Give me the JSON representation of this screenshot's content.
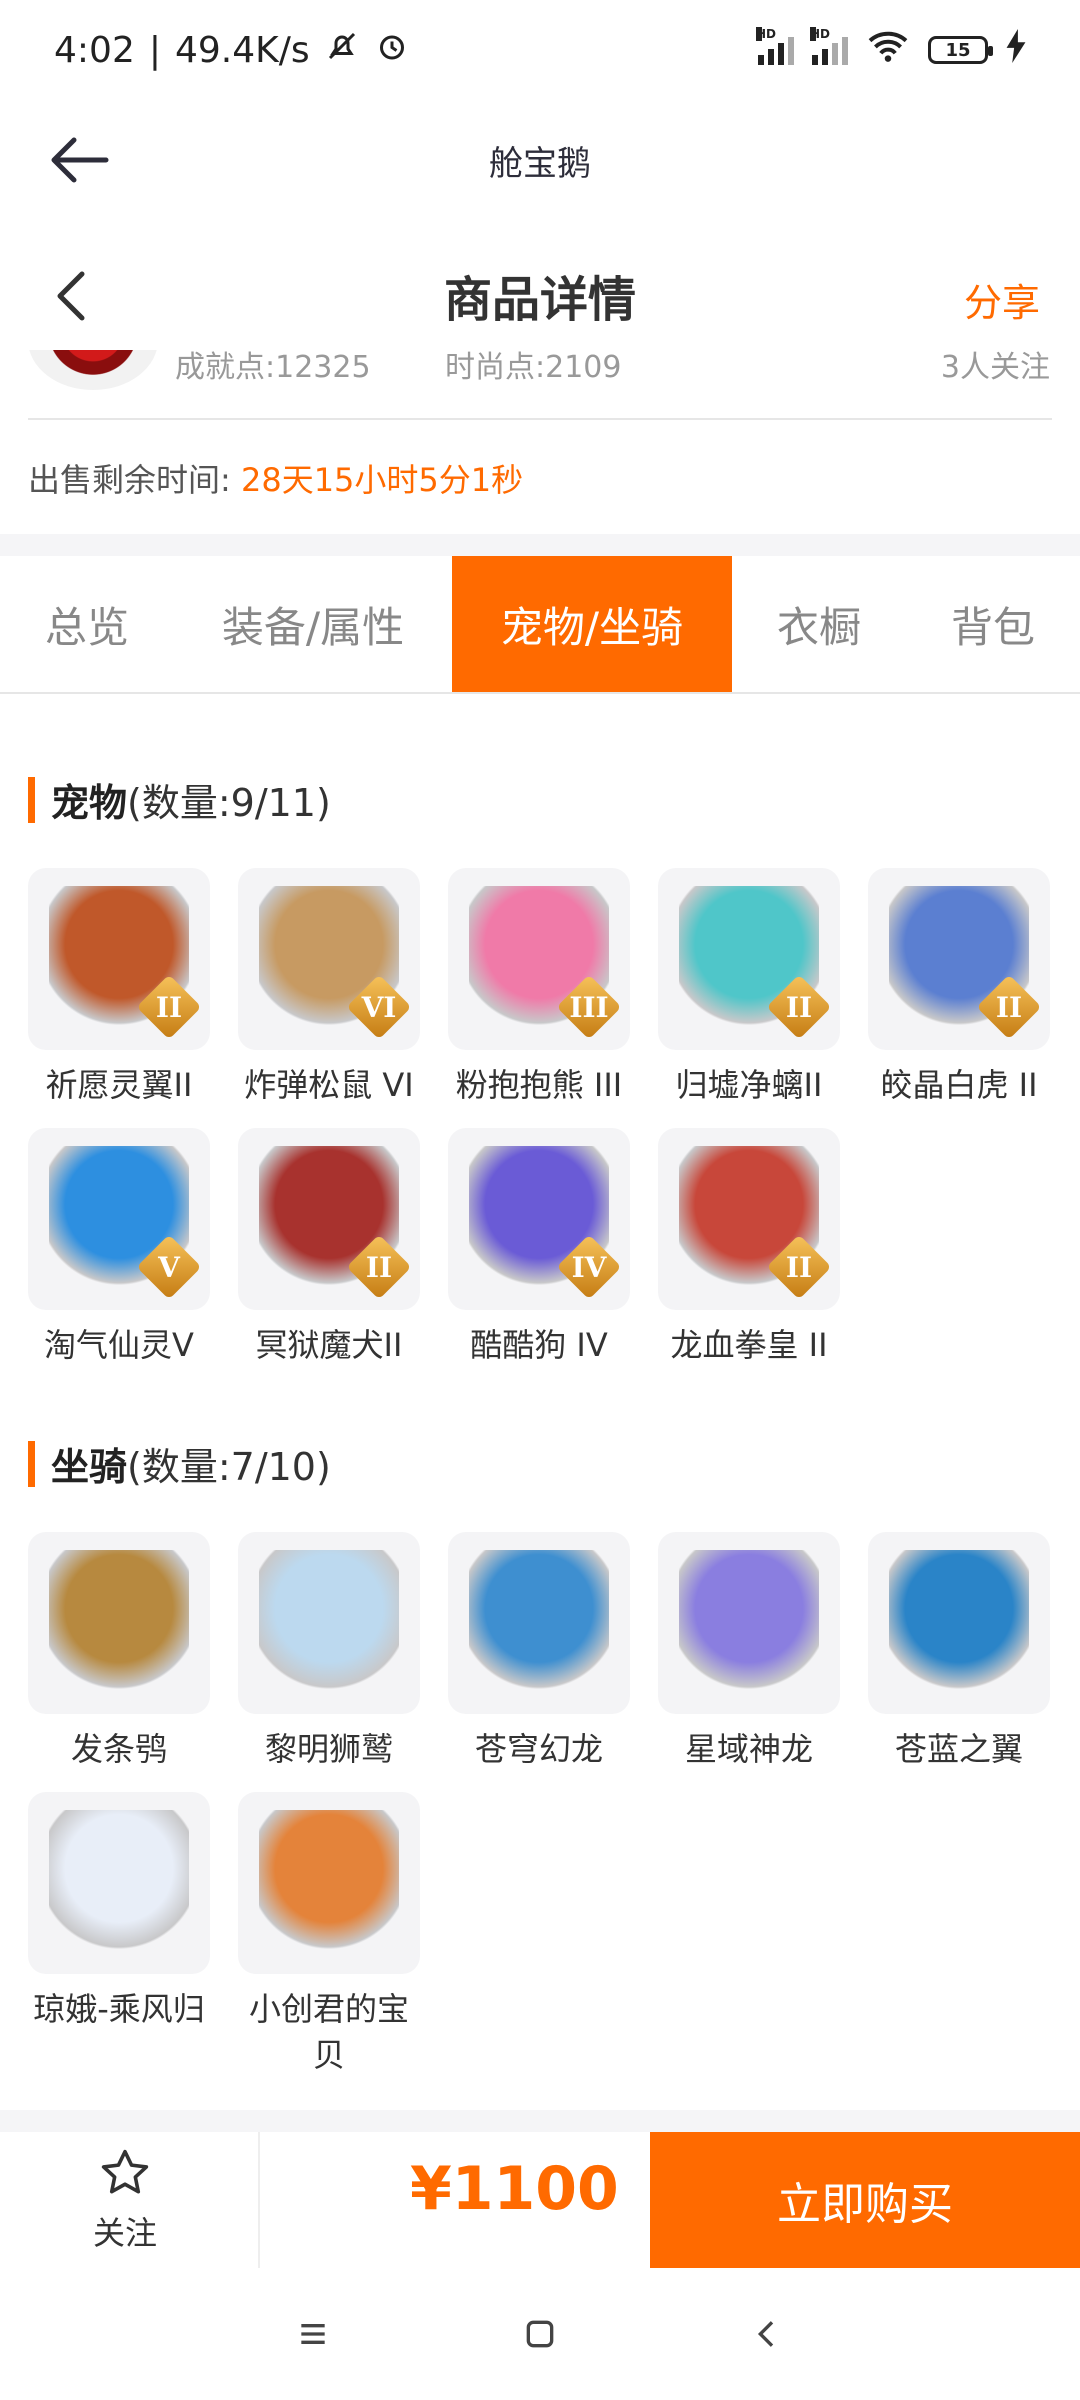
{
  "status": {
    "time": "4:02",
    "speed": "49.4K/s",
    "battery": "15",
    "signal_label": "HD"
  },
  "appbar": {
    "title": "舱宝鹅"
  },
  "header": {
    "title": "商品详情",
    "share": "分享"
  },
  "seller": {
    "stat1": "成就点:12325",
    "stat2": "时尚点:2109",
    "followers": "3人关注"
  },
  "remaining": {
    "label": "出售剩余时间:",
    "value": "28天15小时5分1秒"
  },
  "tabs": [
    {
      "label": "总览"
    },
    {
      "label": "装备/属性"
    },
    {
      "label": "宠物/坐骑"
    },
    {
      "label": "衣橱"
    },
    {
      "label": "背包"
    }
  ],
  "pets": {
    "title": "宠物",
    "count": "(数量:9/11)",
    "items": [
      {
        "name": "祈愿灵翼II",
        "tier": "II",
        "color": "#c0582a"
      },
      {
        "name": "炸弹松鼠 VI",
        "tier": "VI",
        "color": "#c79a62"
      },
      {
        "name": "粉抱抱熊 III",
        "tier": "III",
        "color": "#f07aa8"
      },
      {
        "name": "归墟净螭II",
        "tier": "II",
        "color": "#4fc6c9"
      },
      {
        "name": "皎晶白虎 II",
        "tier": "II",
        "color": "#5b7fd1"
      },
      {
        "name": "淘气仙灵V",
        "tier": "V",
        "color": "#2d8fe0"
      },
      {
        "name": "冥狱魔犬II",
        "tier": "II",
        "color": "#a8322e"
      },
      {
        "name": "酷酷狗 IV",
        "tier": "IV",
        "color": "#6a5bd6"
      },
      {
        "name": "龙血拳皇 II",
        "tier": "II",
        "color": "#c8473a"
      }
    ]
  },
  "mounts": {
    "title": "坐骑",
    "count": "(数量:7/10)",
    "items": [
      {
        "name": "发条鸮",
        "color": "#b7893f"
      },
      {
        "name": "黎明狮鹫",
        "color": "#bcd9ef"
      },
      {
        "name": "苍穹幻龙",
        "color": "#3e8fd0"
      },
      {
        "name": "星域神龙",
        "color": "#8a7ee0"
      },
      {
        "name": "苍蓝之翼",
        "color": "#2a84c8"
      },
      {
        "name": "琼娥-乘风归",
        "color": "#e8eef8"
      },
      {
        "name": "小创君的宝贝",
        "color": "#e4833a"
      }
    ]
  },
  "bottom": {
    "follow": "关注",
    "price": "¥1100",
    "buy": "立即购买"
  }
}
